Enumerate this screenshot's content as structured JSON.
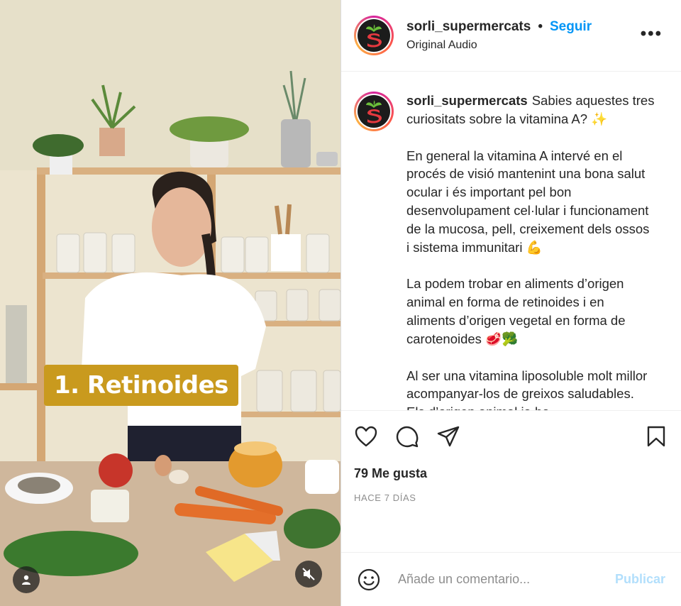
{
  "video": {
    "overlay_text": "1. Retinoides"
  },
  "header": {
    "username": "sorli_supermercats",
    "separator": "•",
    "follow_label": "Seguir",
    "audio_label": "Original Audio",
    "more_label": "•••"
  },
  "caption": {
    "username": "sorli_supermercats",
    "paragraphs": [
      "Sabies aquestes tres curiositats sobre la vitamina A? ✨",
      "En general la vitamina A intervé en el procés de visió mantenint una bona salut ocular i és important pel bon desenvolupament cel·lular i funcionament de la mucosa, pell, creixement dels ossos i sistema immunitari 💪",
      "La podem trobar en aliments d’origen animal en forma de retinoides i en aliments d’origen vegetal en forma de carotenoides 🥩🥦",
      "Al ser una vitamina liposoluble molt millor acompanyar-los de greixos saludables. Els d’origen animal ja ho"
    ]
  },
  "stats": {
    "likes": "79 Me gusta",
    "time": "HACE 7 DÍAS"
  },
  "comment_box": {
    "placeholder": "Añade un comentario...",
    "publish_label": "Publicar"
  },
  "colors": {
    "accent": "#0095f6",
    "publish_disabled": "#b2dffc",
    "overlay_chip": "#c99a1e"
  }
}
